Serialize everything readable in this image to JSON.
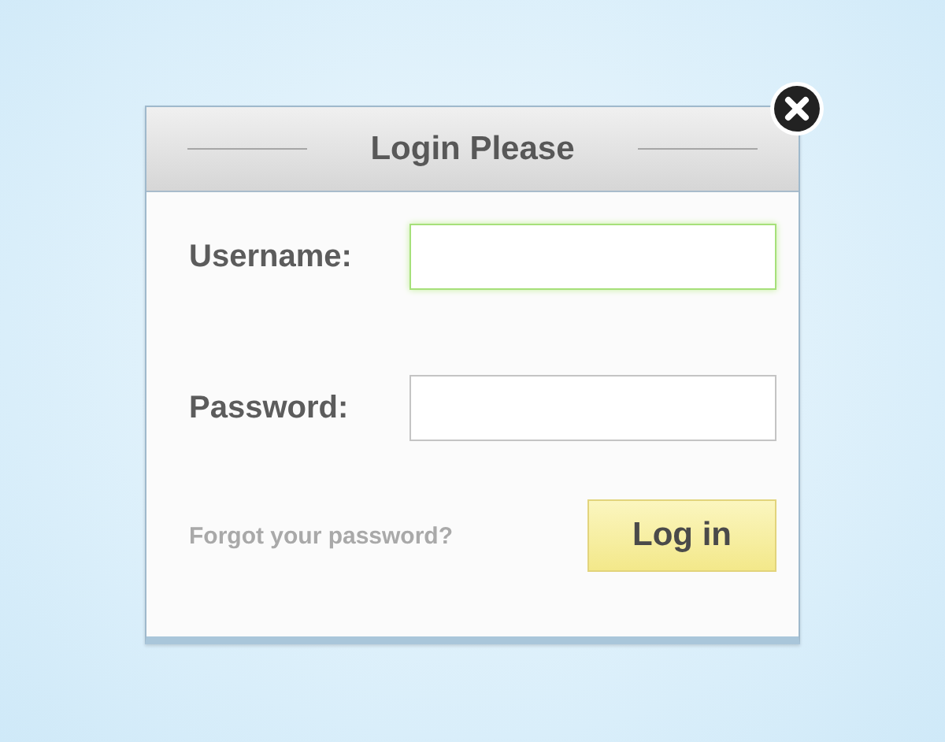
{
  "dialog": {
    "title": "Login Please"
  },
  "fields": [
    {
      "label": "Username:",
      "focused": true
    },
    {
      "label": "Password:",
      "focused": false
    }
  ],
  "forgot_link": "Forgot your password?",
  "login_button": "Log in"
}
